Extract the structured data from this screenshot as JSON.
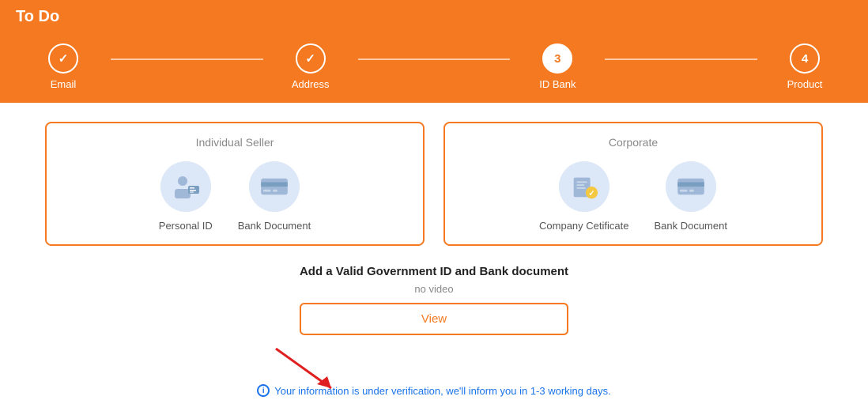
{
  "header": {
    "title": "To Do"
  },
  "stepper": {
    "steps": [
      {
        "id": "email",
        "label": "Email",
        "state": "completed",
        "number": "✓"
      },
      {
        "id": "address",
        "label": "Address",
        "state": "completed",
        "number": "✓"
      },
      {
        "id": "id_bank",
        "label": "ID Bank",
        "state": "active",
        "number": "3"
      },
      {
        "id": "product",
        "label": "Product",
        "state": "inactive",
        "number": "4"
      }
    ]
  },
  "seller_cards": {
    "individual": {
      "title": "Individual Seller",
      "items": [
        {
          "label": "Personal ID",
          "icon": "person-id-icon"
        },
        {
          "label": "Bank Document",
          "icon": "bank-card-icon"
        }
      ]
    },
    "corporate": {
      "title": "Corporate",
      "items": [
        {
          "label": "Company Cetificate",
          "icon": "company-cert-icon"
        },
        {
          "label": "Bank Document",
          "icon": "bank-card-icon-2"
        }
      ]
    }
  },
  "instruction": {
    "title": "Add a Valid Government ID and Bank document",
    "no_video": "no video",
    "view_button": "View",
    "info_message": "Your information is under verification, we'll inform you in 1-3 working days."
  },
  "colors": {
    "primary": "#f47920",
    "link": "#1a73e8",
    "icon_bg": "#dce7f7",
    "badge_color": "#f5c842"
  }
}
